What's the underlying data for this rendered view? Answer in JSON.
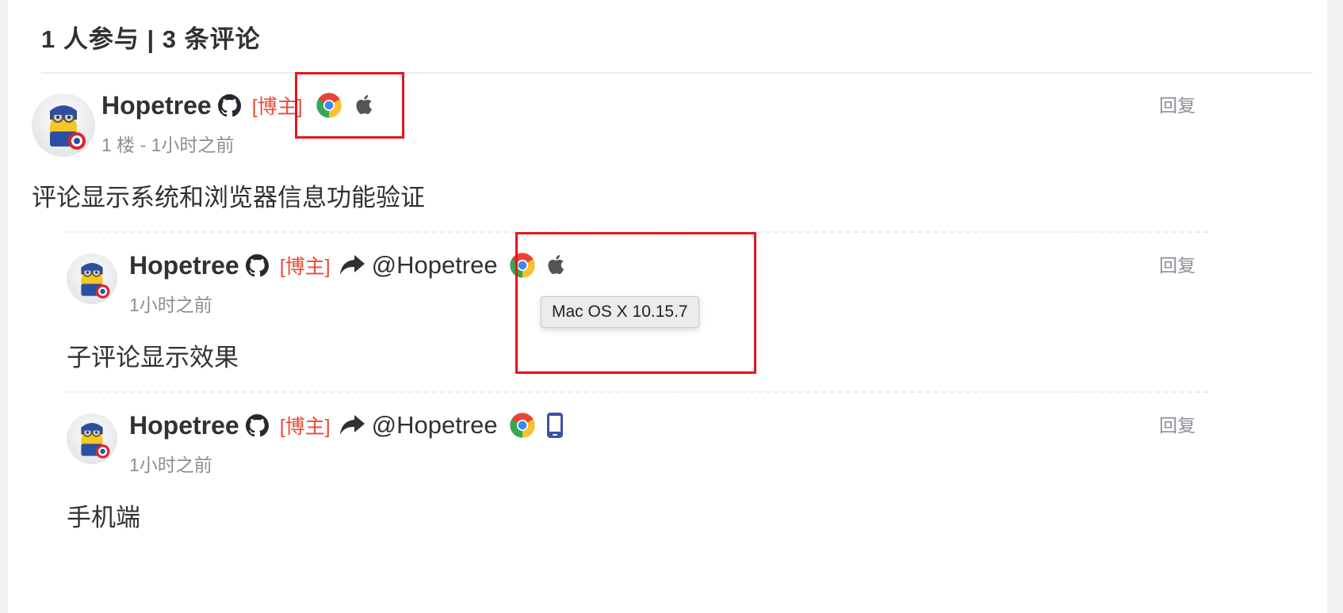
{
  "header": {
    "title": "1 人参与 | 3 条评论"
  },
  "colors": {
    "master_badge": "#e74c3c",
    "highlight_box": "#e8141c",
    "meta_text": "#8a8f99"
  },
  "comments": [
    {
      "nick": "Hopetree",
      "master_label": "[博主]",
      "meta": "1 楼 - 1小时之前",
      "text": "评论显示系统和浏览器信息功能验证",
      "reply_label": "回复",
      "browser_icon": "chrome-icon",
      "os_icon": "apple-icon"
    },
    {
      "nick": "Hopetree",
      "master_label": "[博主]",
      "at": "@Hopetree",
      "meta": "1小时之前",
      "text": "子评论显示效果",
      "reply_label": "回复",
      "browser_icon": "chrome-icon",
      "os_icon": "apple-icon",
      "os_tooltip": "Mac OS X 10.15.7"
    },
    {
      "nick": "Hopetree",
      "master_label": "[博主]",
      "at": "@Hopetree",
      "meta": "1小时之前",
      "text": "手机端",
      "reply_label": "回复",
      "browser_icon": "chrome-icon",
      "os_icon": "mobile-phone-icon"
    }
  ]
}
